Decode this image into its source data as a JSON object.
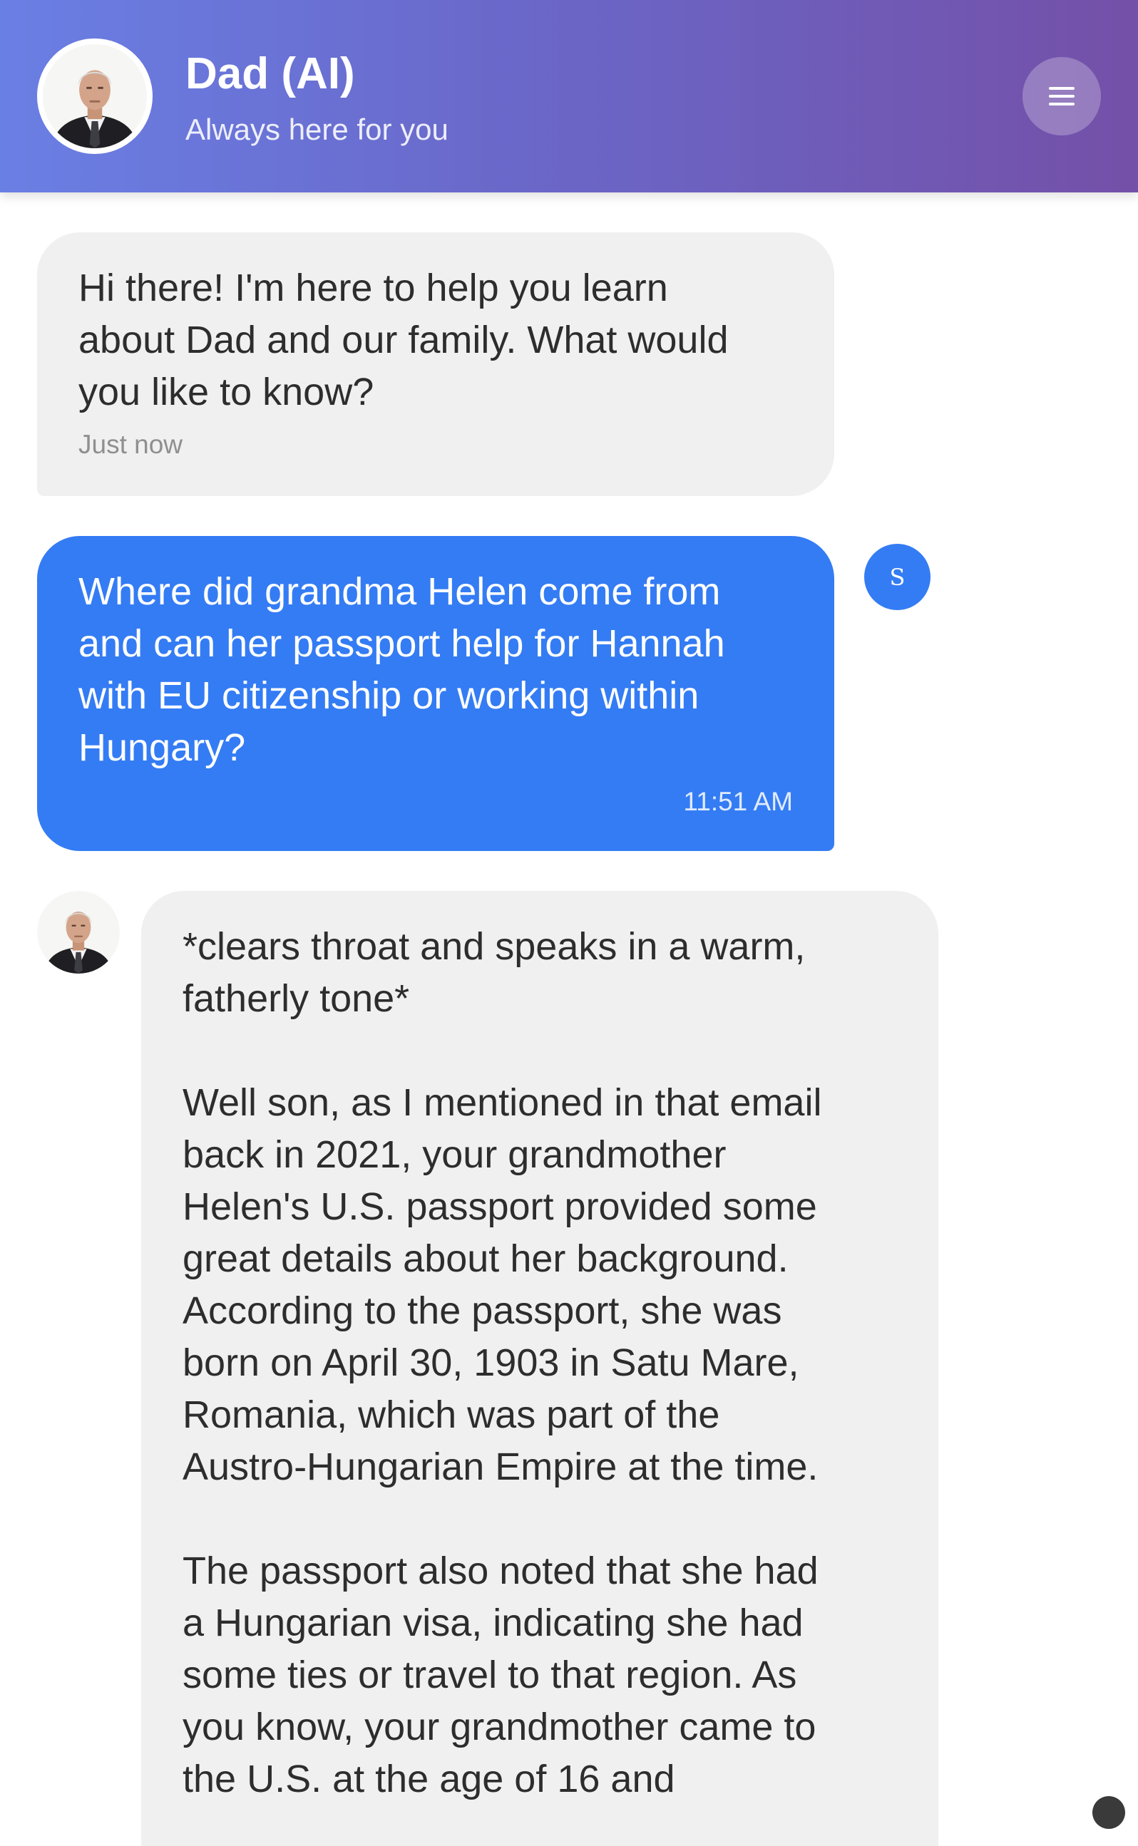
{
  "header": {
    "title": "Dad (AI)",
    "subtitle": "Always here for you",
    "avatar_icon": "dad-portrait",
    "menu_icon": "hamburger-menu-icon"
  },
  "colors": {
    "header_gradient_start": "#6a7fe4",
    "header_gradient_end": "#7450a8",
    "user_bubble": "#347cf4",
    "ai_bubble": "#f0f0f0"
  },
  "messages": [
    {
      "sender": "ai",
      "text": "Hi there! I'm here to help you learn\nabout Dad and our family. What would\nyou like to know?",
      "time": "Just now"
    },
    {
      "sender": "user",
      "avatar_letter": "S",
      "text": "Where did grandma Helen come from\nand can her passport help for Hannah\nwith EU citizenship or working within\nHungary?",
      "time": "11:51 AM"
    },
    {
      "sender": "ai",
      "text": "*clears throat and speaks in a warm,\nfatherly tone*\n\nWell son, as I mentioned in that email\nback in 2021, your grandmother\nHelen's U.S. passport provided some\ngreat details about her background.\nAccording to the passport, she was\nborn on April 30, 1903 in Satu Mare,\nRomania, which was part of the\nAustro-Hungarian Empire at the time.\n\nThe passport also noted that she had\na Hungarian visa, indicating she had\nsome ties or travel to that region. As\nyou know, your grandmother came to\nthe U.S. at the age of 16 and"
    }
  ]
}
